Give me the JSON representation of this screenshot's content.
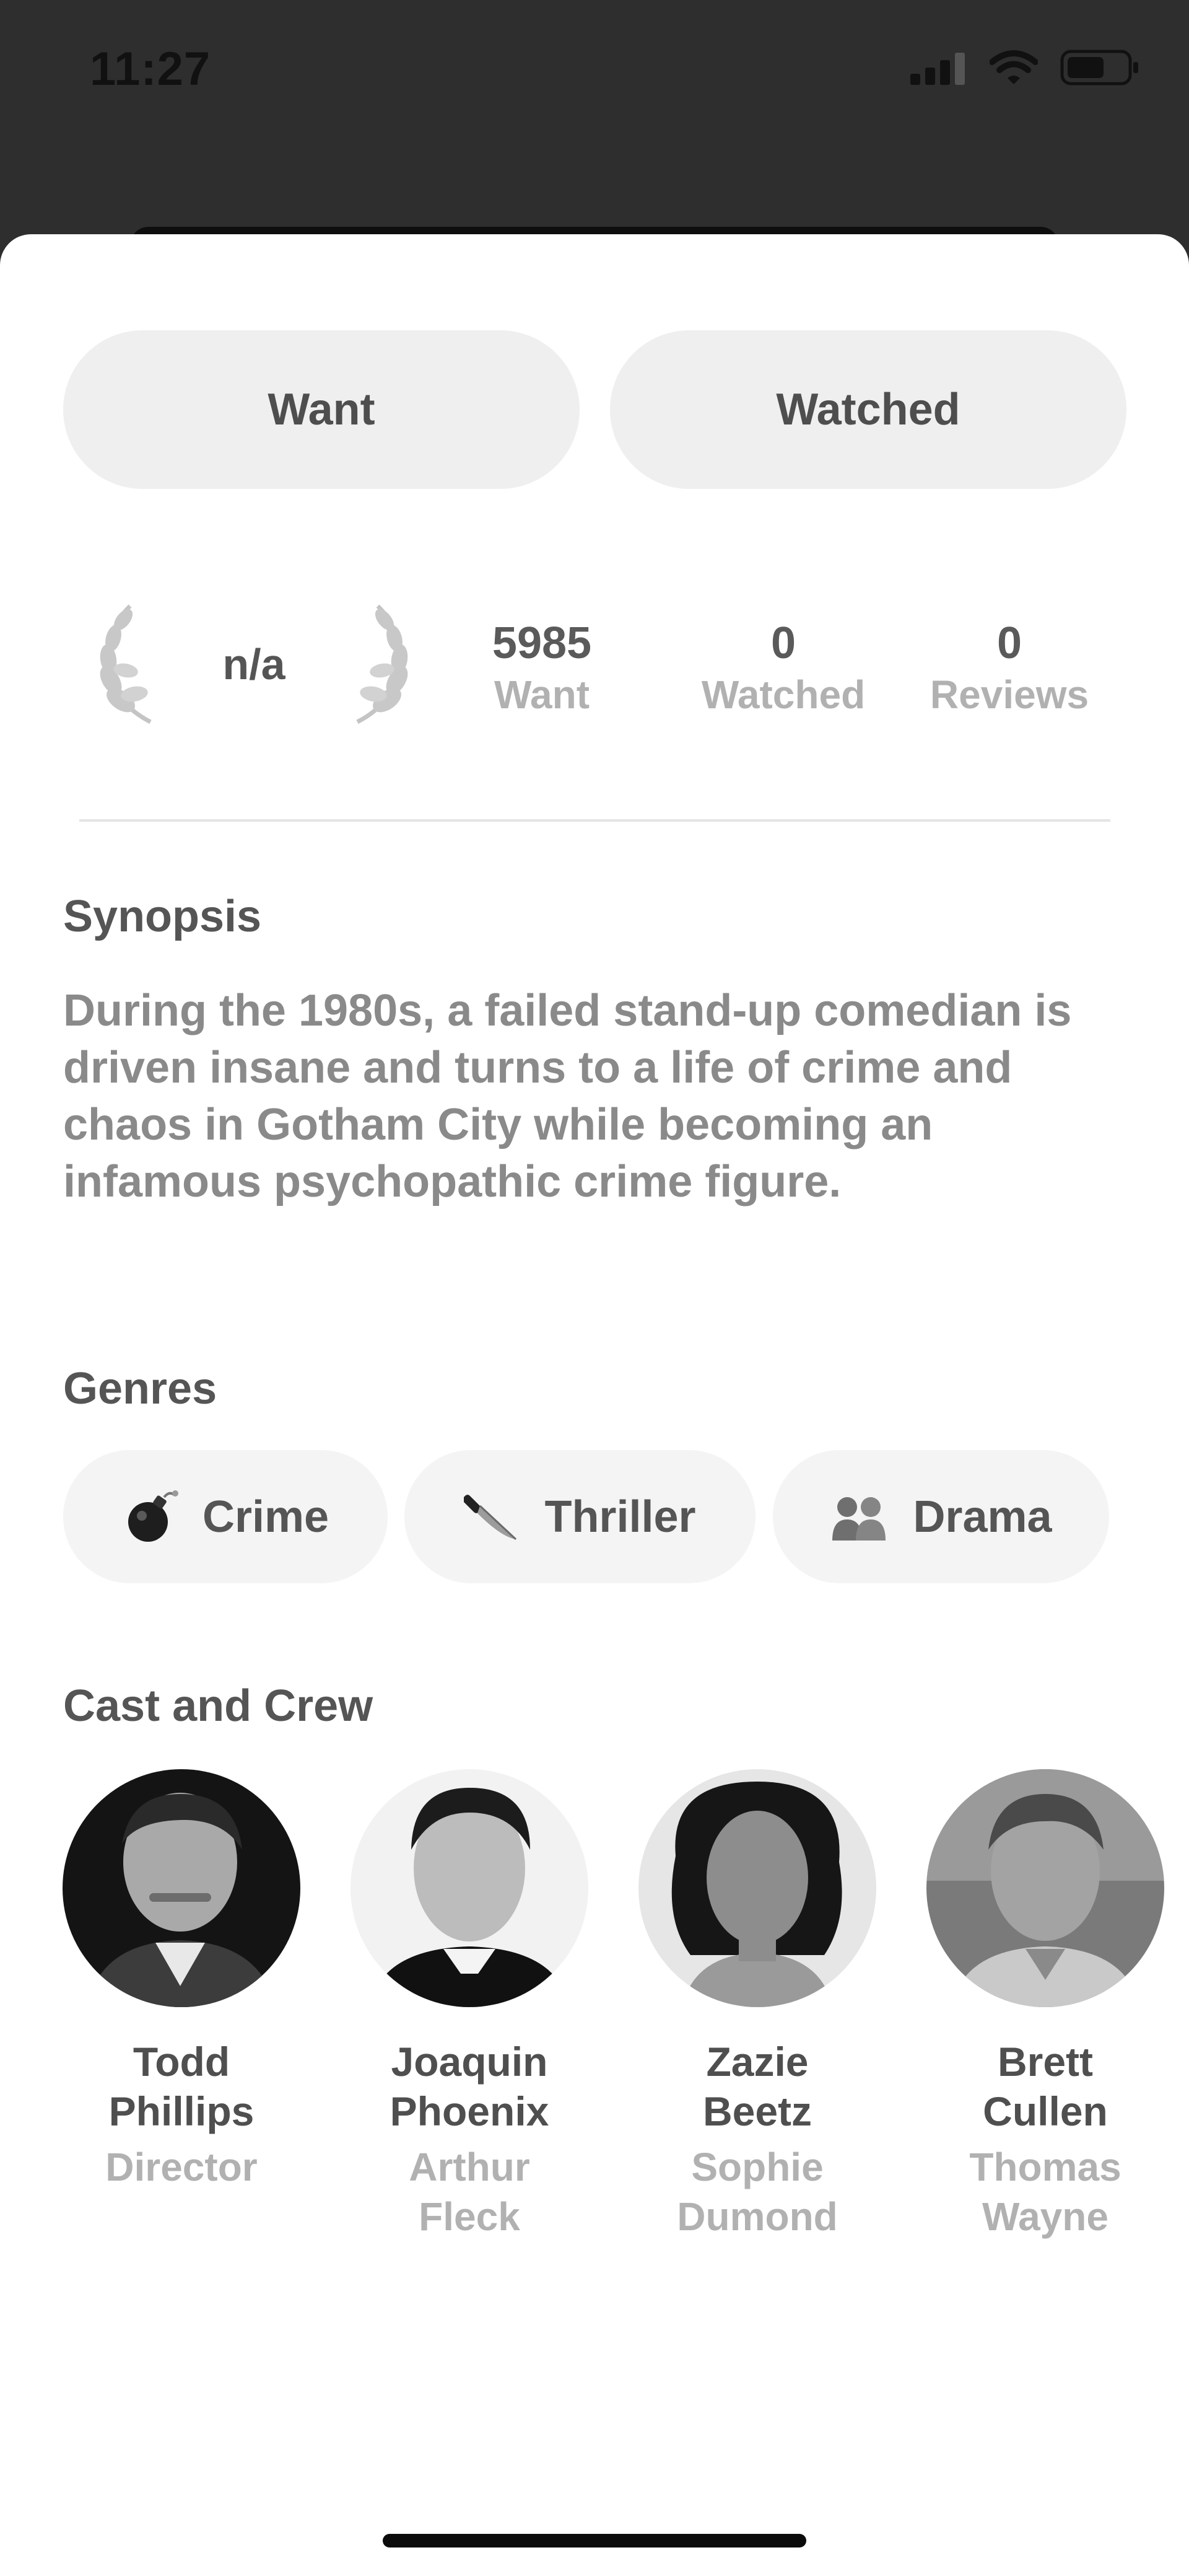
{
  "status_bar": {
    "time": "11:27"
  },
  "actions": {
    "want_label": "Want",
    "watched_label": "Watched"
  },
  "rating": {
    "value": "n/a"
  },
  "stats": [
    {
      "value": "5985",
      "label": "Want"
    },
    {
      "value": "0",
      "label": "Watched"
    },
    {
      "value": "0",
      "label": "Reviews"
    }
  ],
  "synopsis": {
    "title": "Synopsis",
    "text": "During the 1980s, a failed stand-up comedian is driven insane and turns to a life of crime and chaos in Gotham City while becoming an infamous psychopathic crime figure."
  },
  "genres": {
    "title": "Genres",
    "items": [
      {
        "label": "Crime",
        "icon": "bomb-icon"
      },
      {
        "label": "Thriller",
        "icon": "knife-icon"
      },
      {
        "label": "Drama",
        "icon": "people-icon"
      }
    ]
  },
  "cast": {
    "title": "Cast and Crew",
    "members": [
      {
        "name": "Todd Phillips",
        "role": "Director"
      },
      {
        "name": "Joaquin Phoenix",
        "role": "Arthur Fleck"
      },
      {
        "name": "Zazie Beetz",
        "role": "Sophie Dumond"
      },
      {
        "name": "Brett Cullen",
        "role": "Thomas Wayne"
      }
    ]
  },
  "colors": {
    "background": "#2e2e2e",
    "sheet": "#ffffff",
    "button": "#efefef",
    "text_primary": "#555555",
    "text_muted": "#b1b1b1"
  }
}
